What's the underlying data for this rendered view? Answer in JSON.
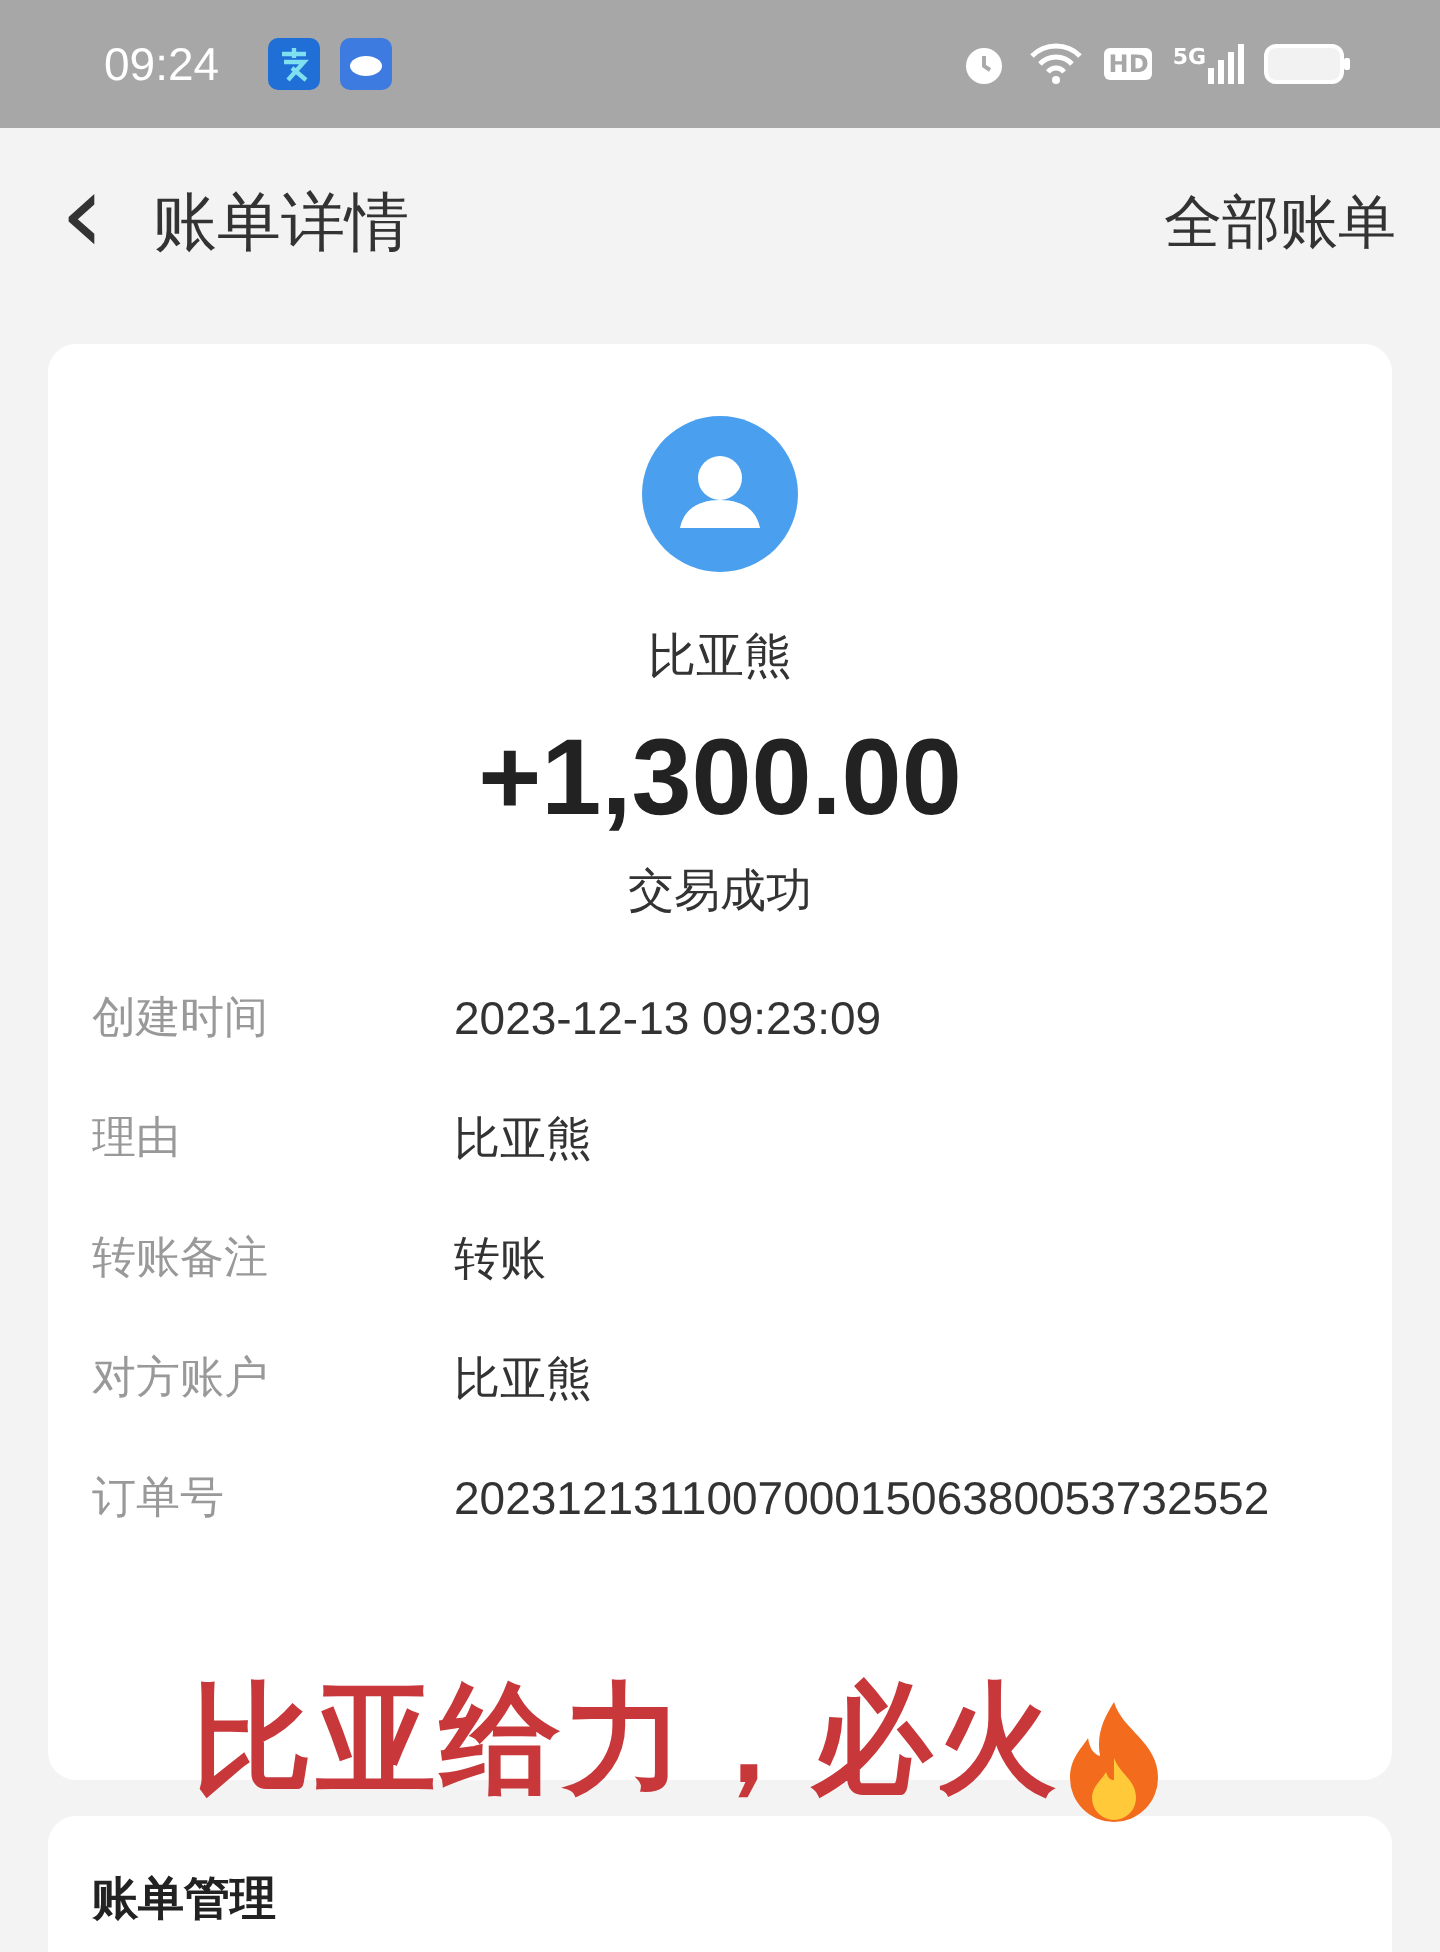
{
  "status_bar": {
    "time": "09:24",
    "hd": "HD",
    "network": "5G"
  },
  "header": {
    "back": "‹",
    "title": "账单详情",
    "action": "全部账单"
  },
  "summary": {
    "name": "比亚熊",
    "amount": "+1,300.00",
    "status": "交易成功"
  },
  "details": [
    {
      "label": "创建时间",
      "value": "2023-12-13 09:23:09"
    },
    {
      "label": "理由",
      "value": "比亚熊"
    },
    {
      "label": "转账备注",
      "value": "转账"
    },
    {
      "label": "对方账户",
      "value": "比亚熊"
    },
    {
      "label": "订单号",
      "value": "20231213110070001506380053732552"
    }
  ],
  "caption": "比亚给力，必火",
  "management": {
    "title": "账单管理"
  }
}
